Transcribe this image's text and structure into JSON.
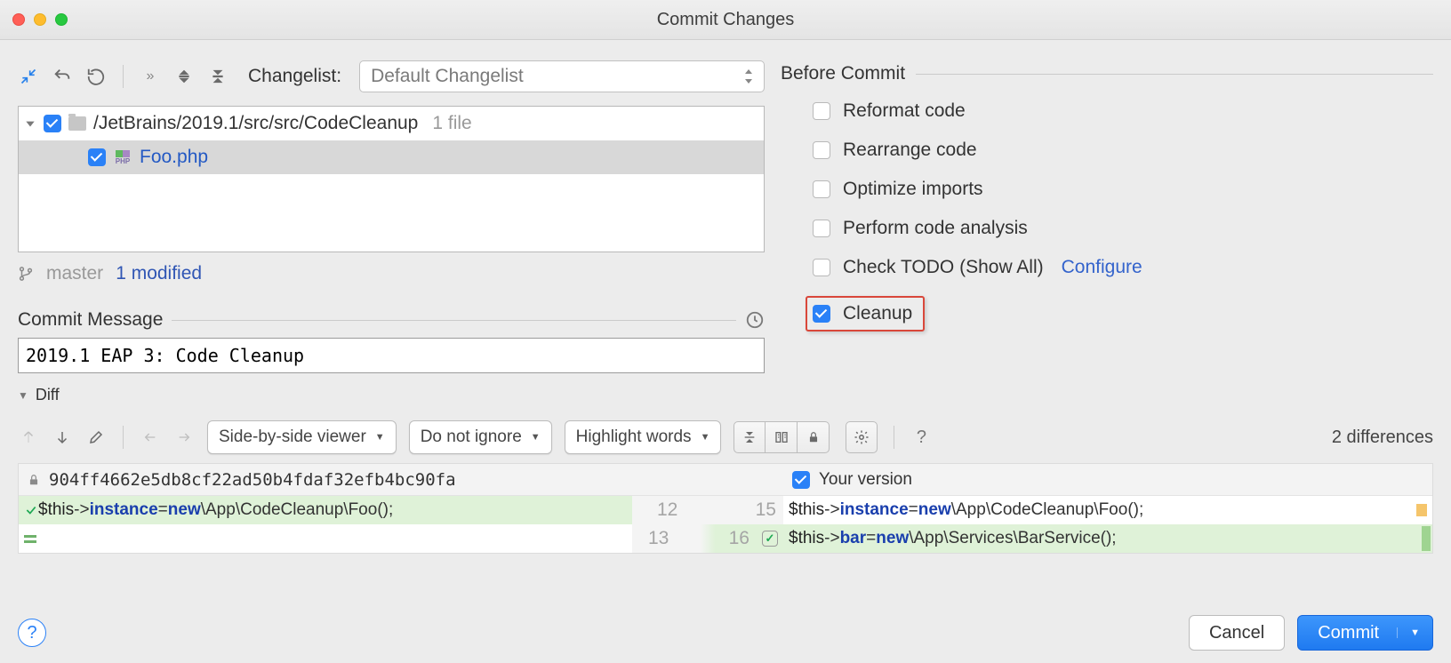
{
  "window": {
    "title": "Commit Changes"
  },
  "toolbar": {
    "changelist_label": "Changelist:",
    "changelist_value": "Default Changelist"
  },
  "tree": {
    "folder": {
      "path": "/JetBrains/2019.1/src/src/CodeCleanup",
      "count": "1 file"
    },
    "file": {
      "name": "Foo.php",
      "icon_label": "PHP"
    },
    "branch_name": "master",
    "modified": "1 modified"
  },
  "commit_msg": {
    "header": "Commit Message",
    "value": "2019.1 EAP 3: Code Cleanup"
  },
  "before": {
    "header": "Before Commit",
    "opts": {
      "reformat": "Reformat code",
      "rearrange": "Rearrange code",
      "optimize": "Optimize imports",
      "analysis": "Perform code analysis",
      "todo": "Check TODO (Show All)",
      "configure": "Configure",
      "cleanup": "Cleanup"
    }
  },
  "diff": {
    "header": "Diff",
    "viewer": "Side-by-side viewer",
    "ignore": "Do not ignore",
    "highlight": "Highlight words",
    "count": "2 differences",
    "left_hash": "904ff4662e5db8cf22ad50b4fdaf32efb4bc90fa",
    "right_label": "Your version",
    "lines": {
      "l12": {
        "ln": "12"
      },
      "l13": {
        "ln": "13"
      },
      "r15": {
        "ln": "15"
      },
      "r16": {
        "ln": "16"
      }
    },
    "code": {
      "this": "$this",
      "arrow": "->",
      "instance": "instance",
      "bar": "bar",
      "eq": " = ",
      "new": "new",
      "sp": " ",
      "foo_ns": "\\App\\CodeCleanup\\",
      "foo_cls": "Foo",
      "bar_ns": "\\App\\Services\\",
      "bar_cls": "BarService",
      "call": "();"
    }
  },
  "footer": {
    "cancel": "Cancel",
    "commit": "Commit"
  }
}
